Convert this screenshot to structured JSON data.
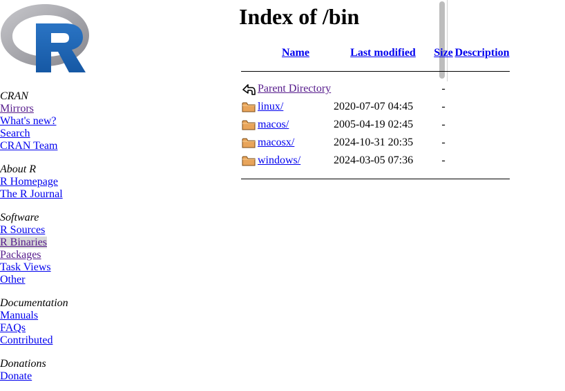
{
  "sidebar": {
    "logo_icon": "r-logo-icon",
    "sections": [
      {
        "heading": "CRAN",
        "links": [
          {
            "label": "Mirrors",
            "visited": true
          },
          {
            "label": "What's new?"
          },
          {
            "label": "Search"
          },
          {
            "label": "CRAN Team"
          }
        ]
      },
      {
        "heading": "About R",
        "links": [
          {
            "label": "R Homepage"
          },
          {
            "label": "The R Journal"
          }
        ]
      },
      {
        "heading": "Software",
        "links": [
          {
            "label": "R Sources"
          },
          {
            "label": "R Binaries",
            "visited": true,
            "active": true
          },
          {
            "label": "Packages",
            "visited": true
          },
          {
            "label": "Task Views"
          },
          {
            "label": "Other"
          }
        ]
      },
      {
        "heading": "Documentation",
        "links": [
          {
            "label": "Manuals"
          },
          {
            "label": "FAQs"
          },
          {
            "label": "Contributed"
          }
        ]
      },
      {
        "heading": "Donations",
        "links": [
          {
            "label": "Donate"
          }
        ]
      }
    ]
  },
  "main": {
    "title": "Index of /bin",
    "columns": {
      "name": "Name",
      "last_modified": "Last modified",
      "size": "Size",
      "description": "Description"
    },
    "rows": [
      {
        "icon": "parent-directory-icon",
        "name": "Parent Directory",
        "modified": "",
        "size": "-",
        "visited": true
      },
      {
        "icon": "folder-icon",
        "name": "linux/",
        "modified": "2020-07-07 04:45",
        "size": "-"
      },
      {
        "icon": "folder-icon",
        "name": "macos/",
        "modified": "2005-04-19 02:45",
        "size": "-"
      },
      {
        "icon": "folder-icon",
        "name": "macosx/",
        "modified": "2024-10-31 20:35",
        "size": "-"
      },
      {
        "icon": "folder-icon",
        "name": "windows/",
        "modified": "2024-03-05 07:36",
        "size": "-"
      }
    ]
  },
  "colors": {
    "link": "#0000ee",
    "visited": "#551a8b",
    "logo_ring": "#a0a0a8",
    "logo_letter": "#1e64b4",
    "folder": "#e3a35b"
  }
}
